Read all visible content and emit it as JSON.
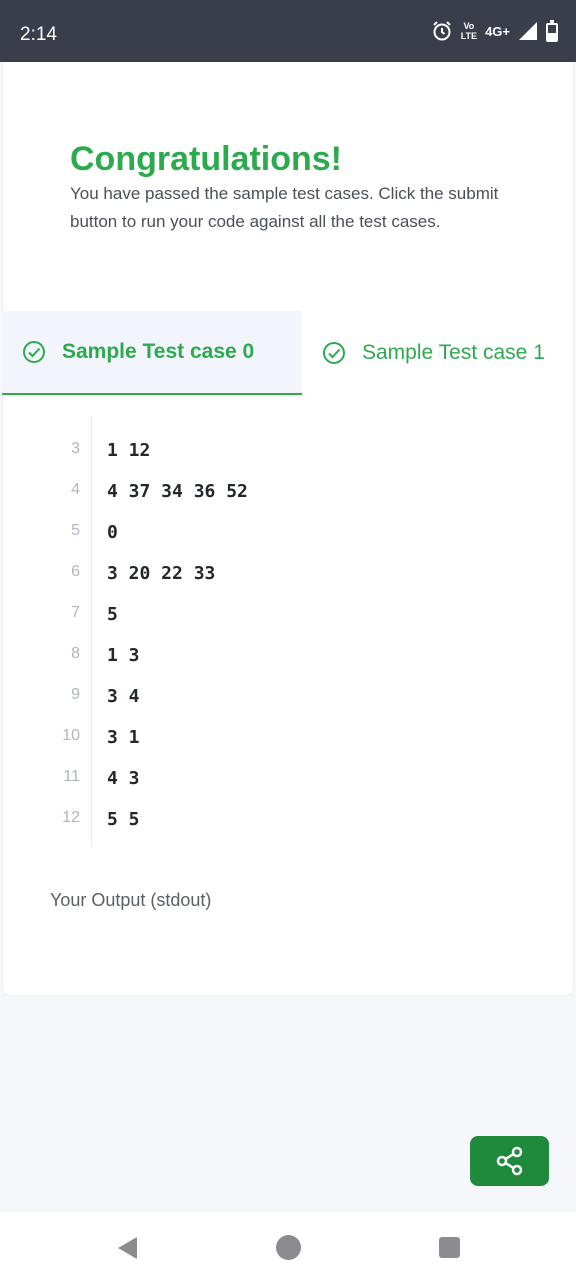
{
  "status_bar": {
    "time": "2:14",
    "volte_top": "Vo",
    "volte_bottom": "LTE",
    "network": "4G+"
  },
  "header": {
    "title": "Congratulations!",
    "message": "You have passed the sample test cases. Click the submit button to run your code against all the test cases."
  },
  "tabs": [
    {
      "label": "Sample Test case 0",
      "selected": true
    },
    {
      "label": "Sample Test case 1",
      "selected": false
    }
  ],
  "code_lines": [
    {
      "num": "3",
      "text": "1 12"
    },
    {
      "num": "4",
      "text": "4 37 34 36 52"
    },
    {
      "num": "5",
      "text": "0"
    },
    {
      "num": "6",
      "text": "3 20 22 33"
    },
    {
      "num": "7",
      "text": "5"
    },
    {
      "num": "8",
      "text": "1 3"
    },
    {
      "num": "9",
      "text": "3 4"
    },
    {
      "num": "10",
      "text": "3 1"
    },
    {
      "num": "11",
      "text": "4 3"
    },
    {
      "num": "12",
      "text": "5 5"
    }
  ],
  "output": {
    "label": "Your Output (stdout)"
  },
  "colors": {
    "accent": "#2eaa4e",
    "share_button": "#1f8a3b",
    "status_bar": "#393e4a"
  },
  "icons": {
    "tab_check": "check-circle-icon",
    "share": "share-icon",
    "alarm": "alarm-icon",
    "signal": "signal-icon",
    "battery": "battery-icon",
    "back": "back-icon",
    "home": "home-icon",
    "recents": "recents-icon"
  }
}
